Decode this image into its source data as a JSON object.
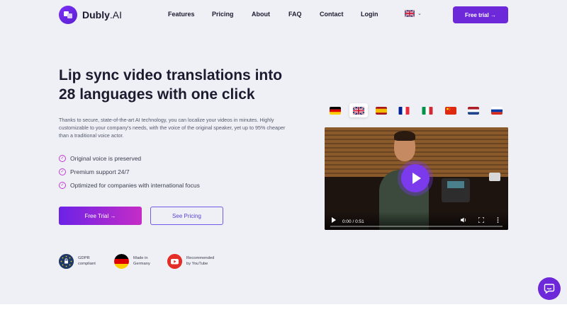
{
  "brand": {
    "name": "Dubly",
    "suffix": ".AI"
  },
  "nav": {
    "items": [
      {
        "label": "Features"
      },
      {
        "label": "Pricing"
      },
      {
        "label": "About"
      },
      {
        "label": "FAQ"
      },
      {
        "label": "Contact"
      },
      {
        "label": "Login"
      }
    ],
    "language_icon": "uk-flag",
    "cta_label": "Free trial →"
  },
  "hero": {
    "title_line1": "Lip sync video translations into",
    "title_line2": "28 languages with one click",
    "description": "Thanks to secure, state-of-the-art AI technology, you can localize your videos in minutes. Highly customizable to your company's needs, with the voice of the original speaker, yet up to 95% cheaper than a traditional voice actor.",
    "bullets": [
      {
        "label": "Original voice is preserved"
      },
      {
        "label": "Premium support 24/7"
      },
      {
        "label": "Optimized for companies with international focus"
      }
    ],
    "primary_cta": "Free Trial →",
    "secondary_cta": "See Pricing"
  },
  "badges": [
    {
      "line1": "GDPR",
      "line2": "compliant",
      "icon": "eu-lock-icon"
    },
    {
      "line1": "Made in",
      "line2": "Germany",
      "icon": "german-flag-icon"
    },
    {
      "line1": "Recommended",
      "line2": "by YouTube",
      "icon": "youtube-icon"
    }
  ],
  "languages": {
    "flags": [
      "germany",
      "united-kingdom",
      "spain",
      "france",
      "italy",
      "china",
      "netherlands",
      "russia"
    ],
    "selected": "united-kingdom"
  },
  "video": {
    "time": "0 / 0:51",
    "time_prefix": "0:00",
    "time_display": "0:00 / 0:51"
  },
  "colors": {
    "accent": "#6d28d9",
    "accent_alt": "#c52cc6",
    "background": "#eef0f6"
  }
}
